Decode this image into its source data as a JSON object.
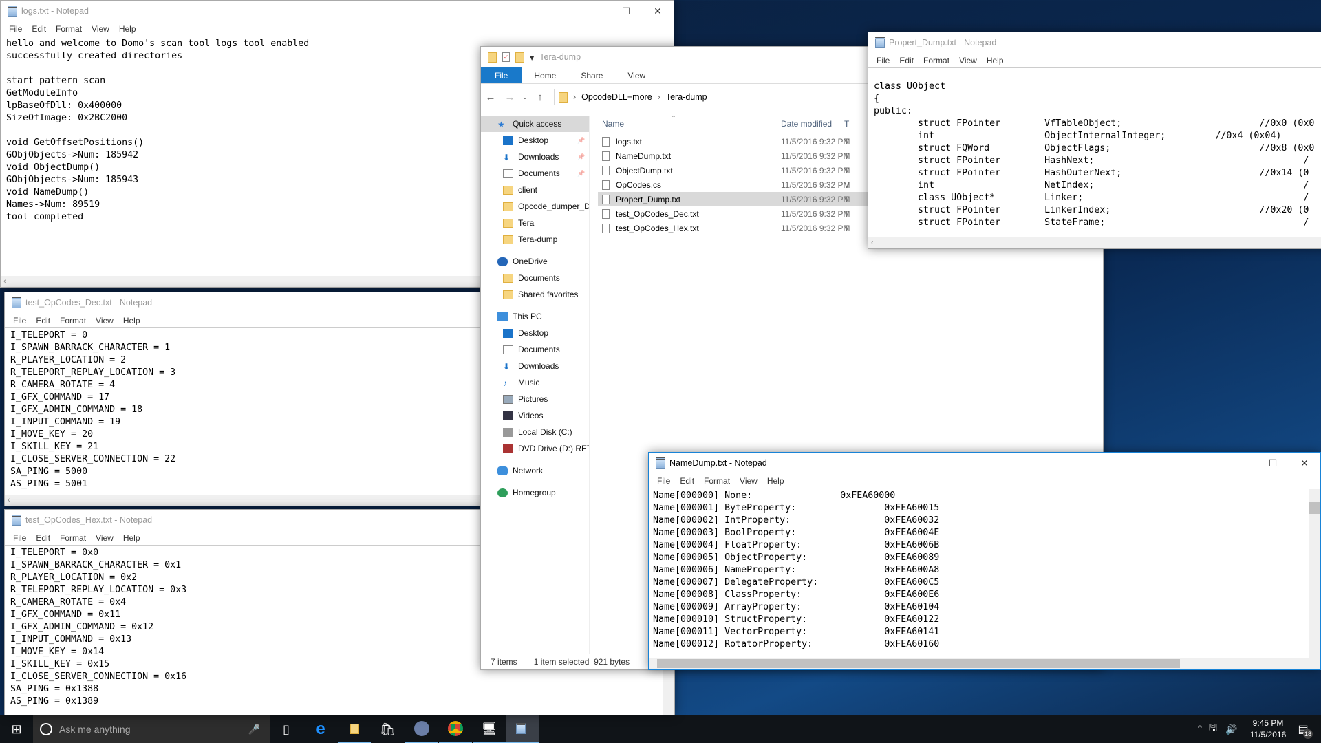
{
  "logs": {
    "title": "logs.txt - Notepad",
    "menu": [
      "File",
      "Edit",
      "Format",
      "View",
      "Help"
    ],
    "lines": [
      "hello and welcome to Domo's scan tool logs tool enabled",
      "successfully created directories",
      "",
      "start pattern scan",
      "GetModuleInfo",
      "lpBaseOfDll: 0x400000",
      "SizeOfImage: 0x2BC2000",
      "",
      "void GetOffsetPositions()",
      "GObjObjects->Num: 185942",
      "void ObjectDump()",
      "GObjObjects->Num: 185943",
      "void NameDump()",
      "Names->Num: 89519",
      "tool completed"
    ]
  },
  "dec": {
    "title": "test_OpCodes_Dec.txt - Notepad",
    "menu": [
      "File",
      "Edit",
      "Format",
      "View",
      "Help"
    ],
    "lines": [
      "I_TELEPORT = 0",
      "I_SPAWN_BARRACK_CHARACTER = 1",
      "R_PLAYER_LOCATION = 2",
      "R_TELEPORT_REPLAY_LOCATION = 3",
      "R_CAMERA_ROTATE = 4",
      "I_GFX_COMMAND = 17",
      "I_GFX_ADMIN_COMMAND = 18",
      "I_INPUT_COMMAND = 19",
      "I_MOVE_KEY = 20",
      "I_SKILL_KEY = 21",
      "I_CLOSE_SERVER_CONNECTION = 22",
      "SA_PING = 5000",
      "AS_PING = 5001"
    ]
  },
  "hex": {
    "title": "test_OpCodes_Hex.txt - Notepad",
    "menu": [
      "File",
      "Edit",
      "Format",
      "View",
      "Help"
    ],
    "lines": [
      "I_TELEPORT = 0x0",
      "I_SPAWN_BARRACK_CHARACTER = 0x1",
      "R_PLAYER_LOCATION = 0x2",
      "R_TELEPORT_REPLAY_LOCATION = 0x3",
      "R_CAMERA_ROTATE = 0x4",
      "I_GFX_COMMAND = 0x11",
      "I_GFX_ADMIN_COMMAND = 0x12",
      "I_INPUT_COMMAND = 0x13",
      "I_MOVE_KEY = 0x14",
      "I_SKILL_KEY = 0x15",
      "I_CLOSE_SERVER_CONNECTION = 0x16",
      "SA_PING = 0x1388",
      "AS_PING = 0x1389"
    ]
  },
  "propert": {
    "title": "Propert_Dump.txt - Notepad",
    "menu": [
      "File",
      "Edit",
      "Format",
      "View",
      "Help"
    ],
    "lines": [
      "",
      "class UObject",
      "{",
      "public:",
      "        struct FPointer        VfTableObject;                         //0x0 (0x0",
      "        int                    ObjectInternalInteger;         //0x4 (0x04)",
      "        struct FQWord          ObjectFlags;                           //0x8 (0x0",
      "        struct FPointer        HashNext;                                      /",
      "        struct FPointer        HashOuterNext;                         //0x14 (0",
      "        int                    NetIndex;                                      /",
      "        class UObject*         Linker;                                        /",
      "        struct FPointer        LinkerIndex;                           //0x20 (0",
      "        struct FPointer        StateFrame;                                    /"
    ]
  },
  "namedump": {
    "title": "NameDump.txt - Notepad",
    "menu": [
      "File",
      "Edit",
      "Format",
      "View",
      "Help"
    ],
    "lines": [
      "Name[000000] None:                0xFEA60000",
      "Name[000001] ByteProperty:                0xFEA60015",
      "Name[000002] IntProperty:                 0xFEA60032",
      "Name[000003] BoolProperty:                0xFEA6004E",
      "Name[000004] FloatProperty:               0xFEA6006B",
      "Name[000005] ObjectProperty:              0xFEA60089",
      "Name[000006] NameProperty:                0xFEA600A8",
      "Name[000007] DelegateProperty:            0xFEA600C5",
      "Name[000008] ClassProperty:               0xFEA600E6",
      "Name[000009] ArrayProperty:               0xFEA60104",
      "Name[000010] StructProperty:              0xFEA60122",
      "Name[000011] VectorProperty:              0xFEA60141",
      "Name[000012] RotatorProperty:             0xFEA60160"
    ]
  },
  "explorer": {
    "title": "Tera-dump",
    "ribbon": [
      "File",
      "Home",
      "Share",
      "View"
    ],
    "breadcrumb": [
      "OpcodeDLL+more",
      "Tera-dump"
    ],
    "columns": {
      "name": "Name",
      "date": "Date modified",
      "type": "T"
    },
    "nav": [
      {
        "label": "Quick access",
        "level": 0,
        "icon": "star-icon"
      },
      {
        "label": "Desktop",
        "level": 1,
        "icon": "desktop-icon",
        "pinned": true
      },
      {
        "label": "Downloads",
        "level": 1,
        "icon": "download-icon",
        "pinned": true
      },
      {
        "label": "Documents",
        "level": 1,
        "icon": "documents-icon",
        "pinned": true
      },
      {
        "label": "client",
        "level": 1,
        "icon": "folder-icon"
      },
      {
        "label": "Opcode_dumper_D",
        "level": 1,
        "icon": "folder-icon"
      },
      {
        "label": "Tera",
        "level": 1,
        "icon": "folder-icon"
      },
      {
        "label": "Tera-dump",
        "level": 1,
        "icon": "folder-icon"
      },
      {
        "label": "OneDrive",
        "level": 0,
        "icon": "onedrive-icon"
      },
      {
        "label": "Documents",
        "level": 1,
        "icon": "folder-icon"
      },
      {
        "label": "Shared favorites",
        "level": 1,
        "icon": "folder-icon"
      },
      {
        "label": "This PC",
        "level": 0,
        "icon": "computer-icon"
      },
      {
        "label": "Desktop",
        "level": 1,
        "icon": "desktop-icon"
      },
      {
        "label": "Documents",
        "level": 1,
        "icon": "documents-icon"
      },
      {
        "label": "Downloads",
        "level": 1,
        "icon": "download-icon"
      },
      {
        "label": "Music",
        "level": 1,
        "icon": "music-icon"
      },
      {
        "label": "Pictures",
        "level": 1,
        "icon": "pictures-icon"
      },
      {
        "label": "Videos",
        "level": 1,
        "icon": "videos-icon"
      },
      {
        "label": "Local Disk (C:)",
        "level": 1,
        "icon": "disk-icon"
      },
      {
        "label": "DVD Drive (D:) RETR",
        "level": 1,
        "icon": "dvd-icon"
      },
      {
        "label": "Network",
        "level": 0,
        "icon": "network-icon"
      },
      {
        "label": "Homegroup",
        "level": 0,
        "icon": "homegroup-icon"
      }
    ],
    "files": [
      {
        "name": "logs.txt",
        "date": "11/5/2016 9:32 PM",
        "type": "T"
      },
      {
        "name": "NameDump.txt",
        "date": "11/5/2016 9:32 PM",
        "type": "T"
      },
      {
        "name": "ObjectDump.txt",
        "date": "11/5/2016 9:32 PM",
        "type": "T"
      },
      {
        "name": "OpCodes.cs",
        "date": "11/5/2016 9:32 PM",
        "type": "V"
      },
      {
        "name": "Propert_Dump.txt",
        "date": "11/5/2016 9:32 PM",
        "type": "T",
        "selected": true
      },
      {
        "name": "test_OpCodes_Dec.txt",
        "date": "11/5/2016 9:32 PM",
        "type": "T"
      },
      {
        "name": "test_OpCodes_Hex.txt",
        "date": "11/5/2016 9:32 PM",
        "type": "T"
      }
    ],
    "status": {
      "count": "7 items",
      "selection": "1 item selected  921 bytes"
    }
  },
  "taskbar": {
    "search_placeholder": "Ask me anything",
    "time": "9:45 PM",
    "date": "11/5/2016",
    "notifications": "18",
    "apps": [
      "task-view-icon",
      "edge-icon",
      "file-explorer-icon",
      "store-icon",
      "ccleaner-icon",
      "chrome-icon",
      "remote-desktop-icon",
      "notepad-icon"
    ]
  },
  "colors": {
    "accent": "#1979ca",
    "selection": "#d9d9d9"
  }
}
